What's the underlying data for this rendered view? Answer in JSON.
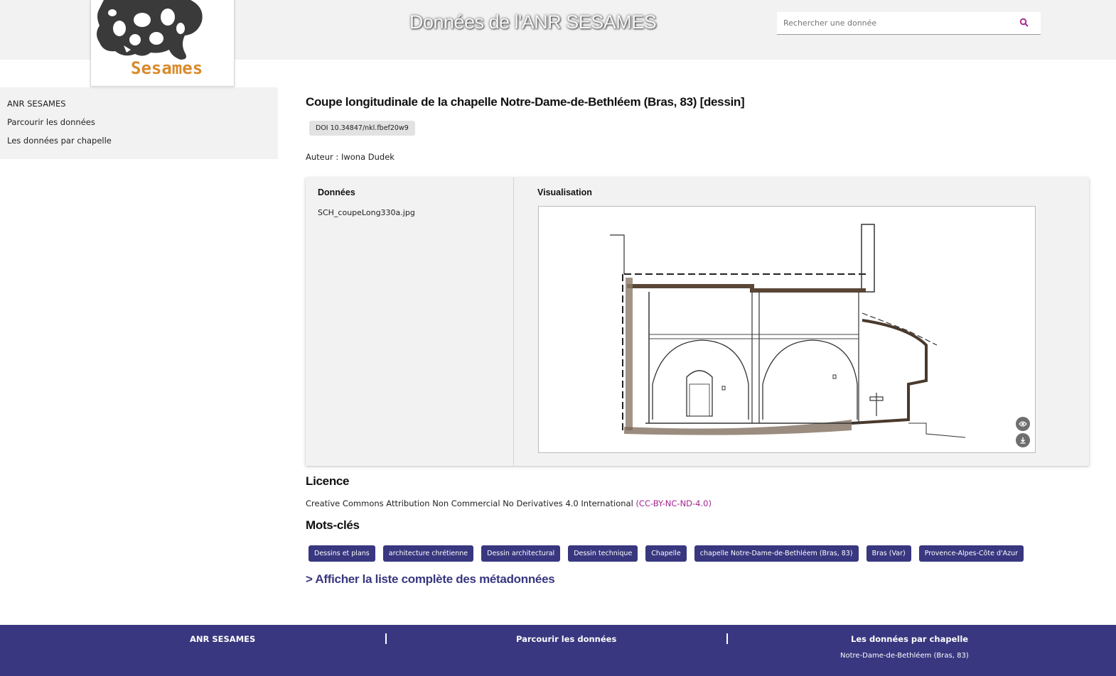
{
  "header": {
    "site_title": "Données de l'ANR SESAMES",
    "logo_text": "Sesames",
    "search_placeholder": "Rechercher une donnée"
  },
  "sidebar": {
    "items": [
      {
        "label": "ANR SESAMES"
      },
      {
        "label": "Parcourir les données"
      },
      {
        "label": "Les données par chapelle"
      }
    ]
  },
  "record": {
    "title": "Coupe longitudinale de la chapelle Notre-Dame-de-Bethléem (Bras, 83) [dessin]",
    "doi": "DOI 10.34847/nkl.fbef20w9",
    "author": "Auteur : Iwona Dudek"
  },
  "panel": {
    "data_heading": "Données",
    "file_name": "SCH_coupeLong330a.jpg",
    "visualisation_heading": "Visualisation"
  },
  "licence": {
    "heading": "Licence",
    "text": "Creative Commons Attribution Non Commercial No Derivatives 4.0 International",
    "code": "(CC-BY-NC-ND-4.0)"
  },
  "keywords": {
    "heading": "Mots-clés",
    "tags": [
      "Dessins et plans",
      "architecture chrétienne",
      "Dessin architectural",
      "Dessin technique",
      "Chapelle",
      "chapelle Notre-Dame-de-Bethléem (Bras, 83)",
      "Bras (Var)",
      "Provence-Alpes-Côte d'Azur"
    ]
  },
  "metadata_link": "> Afficher la liste complète des métadonnées",
  "footer": {
    "col1": "ANR SESAMES",
    "col2": "Parcourir les données",
    "col3": "Les données par chapelle",
    "col3_sub": "Notre-Dame-de-Bethléem (Bras, 83)"
  },
  "colors": {
    "accent": "#38377f",
    "link": "#a3238e",
    "panel_bg": "#f2f2f2"
  }
}
